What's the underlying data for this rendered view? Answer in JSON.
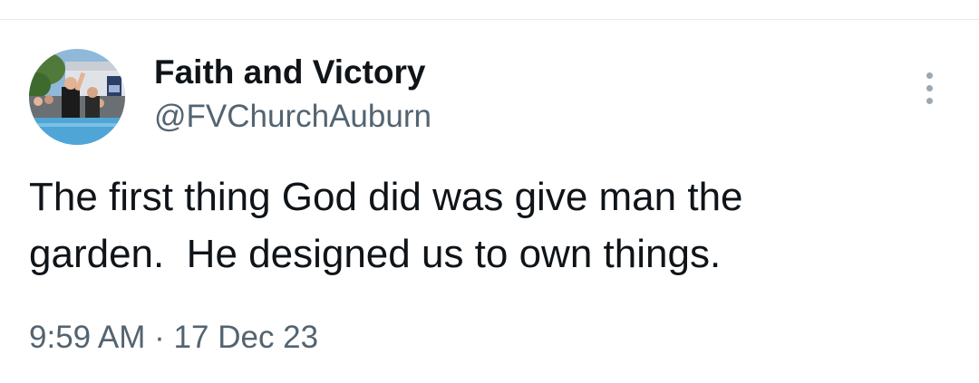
{
  "tweet": {
    "author": {
      "display_name": "Faith and Victory",
      "handle": "@FVChurchAuburn",
      "avatar_icon": "profile-photo"
    },
    "text": "The first thing God did was give man the\ngarden.  He designed us to own things.",
    "time": "9:59 AM",
    "separator": "·",
    "date": "17 Dec 23",
    "more_icon": "vertical-ellipsis-icon"
  },
  "colors": {
    "text_primary": "#0f1419",
    "text_secondary": "#536471",
    "divider": "#e6e9ec",
    "icon_gray": "#9ca7b0"
  }
}
